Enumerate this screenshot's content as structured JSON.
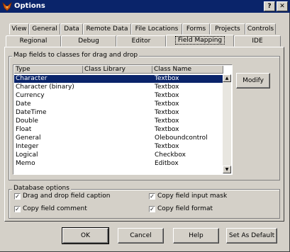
{
  "window": {
    "title": "Options",
    "close_glyph": "✕"
  },
  "tabs_row1": [
    {
      "label": "View"
    },
    {
      "label": "General"
    },
    {
      "label": "Data"
    },
    {
      "label": "Remote Data"
    },
    {
      "label": "File Locations"
    },
    {
      "label": "Forms"
    },
    {
      "label": "Projects"
    },
    {
      "label": "Controls"
    }
  ],
  "tabs_row2": [
    {
      "label": "Regional"
    },
    {
      "label": "Debug"
    },
    {
      "label": "Editor"
    },
    {
      "label": "Field Mapping"
    },
    {
      "label": "IDE"
    }
  ],
  "mapfields": {
    "group_label": "Map fields to classes for drag and drop",
    "columns": [
      "Type",
      "Class Library",
      "Class Name"
    ],
    "rows": [
      {
        "type": "Character",
        "library": "",
        "class": "Textbox",
        "selected": true
      },
      {
        "type": "Character (binary)",
        "library": "",
        "class": "Textbox"
      },
      {
        "type": "Currency",
        "library": "",
        "class": "Textbox"
      },
      {
        "type": "Date",
        "library": "",
        "class": "Textbox"
      },
      {
        "type": "DateTime",
        "library": "",
        "class": "Textbox"
      },
      {
        "type": "Double",
        "library": "",
        "class": "Textbox"
      },
      {
        "type": "Float",
        "library": "",
        "class": "Textbox"
      },
      {
        "type": "General",
        "library": "",
        "class": "Oleboundcontrol"
      },
      {
        "type": "Integer",
        "library": "",
        "class": "Textbox"
      },
      {
        "type": "Logical",
        "library": "",
        "class": "Checkbox"
      },
      {
        "type": "Memo",
        "library": "",
        "class": "Editbox"
      }
    ],
    "modify_label": "Modify",
    "scroll_up": "▲",
    "scroll_down": "▼"
  },
  "dbopts": {
    "group_label": "Database options",
    "checks": [
      {
        "label": "Drag and drop field caption",
        "checked": true
      },
      {
        "label": "Copy field comment",
        "checked": true
      },
      {
        "label": "Copy field input mask",
        "checked": true
      },
      {
        "label": "Copy field format",
        "checked": true
      }
    ],
    "check_glyph": "✓"
  },
  "buttons": {
    "ok": "OK",
    "cancel": "Cancel",
    "help": "Help",
    "set_default": "Set As Default"
  }
}
